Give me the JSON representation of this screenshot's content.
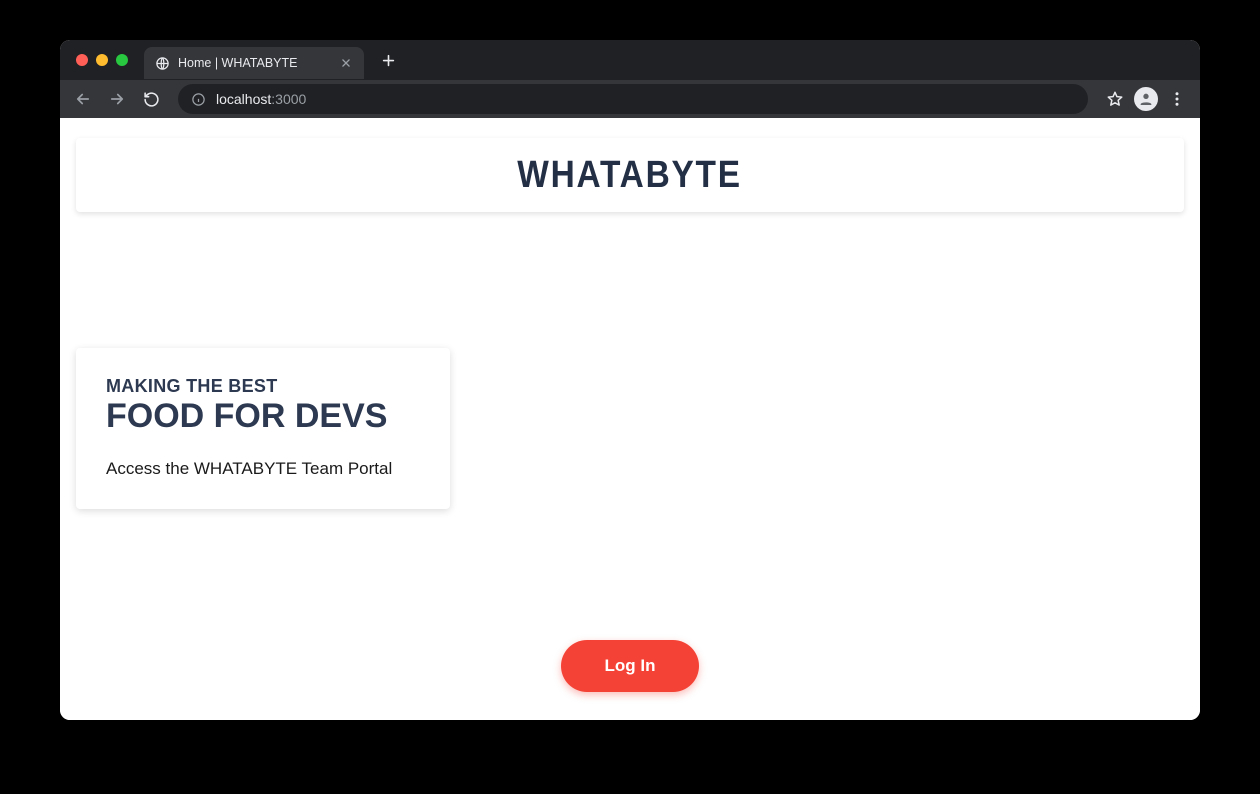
{
  "browser": {
    "tab_title": "Home | WHATABYTE",
    "url_host": "localhost",
    "url_port": ":3000"
  },
  "page": {
    "brand": "WHATABYTE",
    "hero": {
      "overline": "MAKING THE BEST",
      "title": "FOOD FOR DEVS",
      "description": "Access the WHATABYTE Team Portal"
    },
    "login_label": "Log In"
  }
}
